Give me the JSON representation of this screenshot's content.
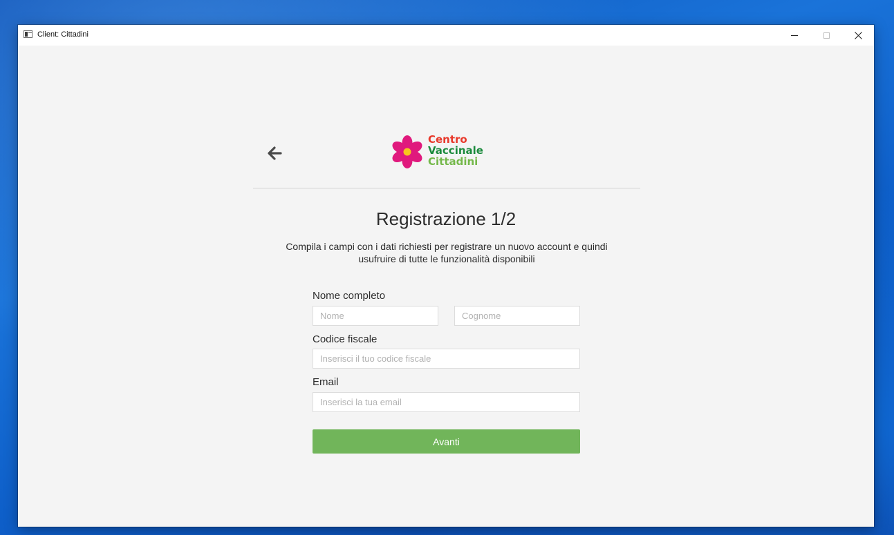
{
  "window": {
    "title": "Client: Cittadini",
    "controls": {
      "minimize_icon": "minimize-icon",
      "maximize_icon": "maximize-icon",
      "close_icon": "close-icon"
    }
  },
  "header": {
    "back_icon": "arrow-left-icon",
    "logo": {
      "icon": "flower-logo-icon",
      "line1": "Centro",
      "line2": "Vaccinale",
      "line3": "Cittadini"
    }
  },
  "main": {
    "title": "Registrazione 1/2",
    "subtitle_line1": "Compila i campi con i dati richiesti per registrare un nuovo account e quindi",
    "subtitle_line2": "usufruire di tutte le funzionalità disponibili"
  },
  "form": {
    "full_name_label": "Nome completo",
    "first_name": {
      "value": "",
      "placeholder": "Nome"
    },
    "last_name": {
      "value": "",
      "placeholder": "Cognome"
    },
    "fiscal_code_label": "Codice fiscale",
    "fiscal_code": {
      "value": "",
      "placeholder": "Inserisci il tuo codice fiscale"
    },
    "email_label": "Email",
    "email": {
      "value": "",
      "placeholder": "Inserisci la tua email"
    },
    "submit_label": "Avanti"
  },
  "colors": {
    "background": "#f4f4f4",
    "accent_green": "#71b55a",
    "logo_red": "#e8392b",
    "logo_dark_green": "#1a8a3c",
    "logo_light_green": "#74b84a",
    "logo_pink": "#e0197d",
    "logo_yellow": "#f7c51e"
  }
}
